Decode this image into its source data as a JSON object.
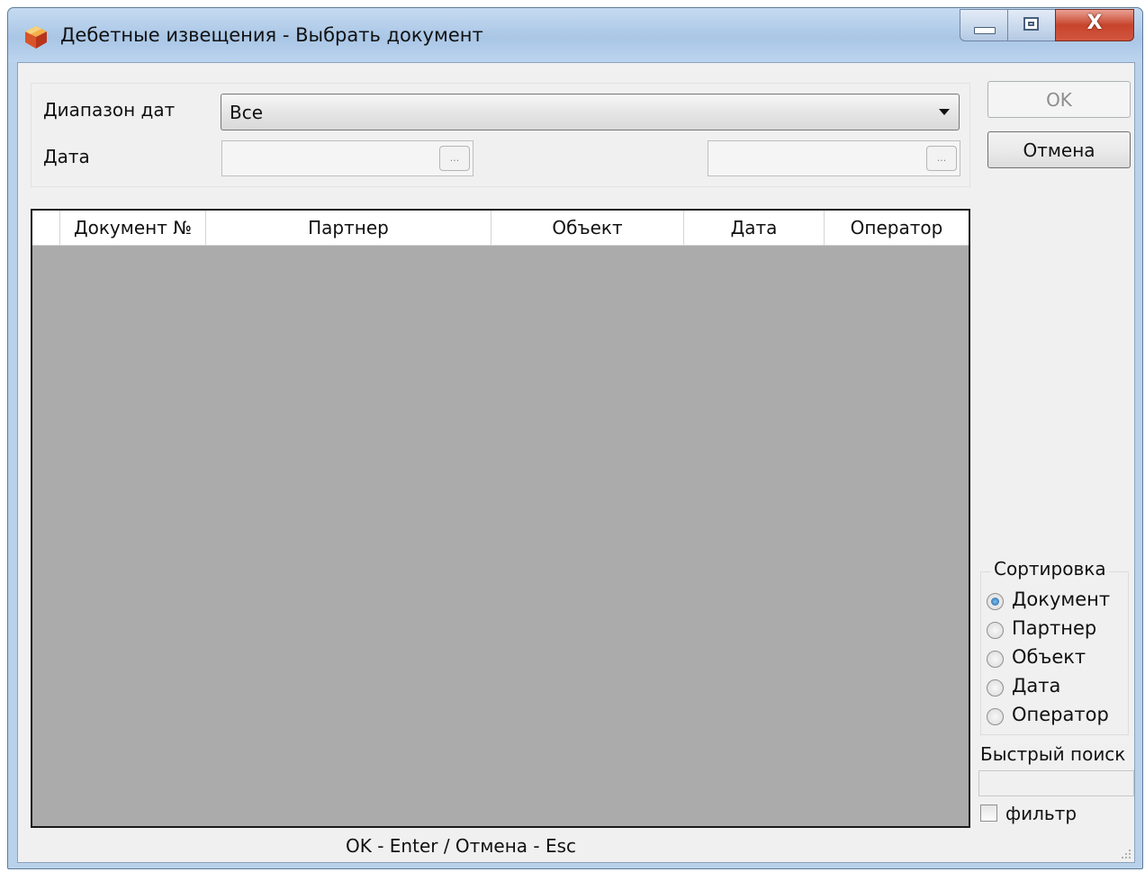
{
  "window": {
    "title": "Дебетные извещения - Выбрать документ",
    "close_glyph": "X",
    "accent_color": "#b9d1ea"
  },
  "filter": {
    "date_range_label": "Диапазон дат",
    "date_range_value": "Все",
    "date_label": "Дата",
    "browse_glyph": "..."
  },
  "buttons": {
    "ok": "OK",
    "cancel": "Отмена"
  },
  "table": {
    "columns": [
      "Документ №",
      "Партнер",
      "Объект",
      "Дата",
      "Оператор"
    ],
    "rows": []
  },
  "sort": {
    "legend": "Сортировка",
    "options": [
      "Документ",
      "Партнер",
      "Объект",
      "Дата",
      "Оператор"
    ],
    "selected": "Документ"
  },
  "quick_search": {
    "label": "Быстрый поиск",
    "value": ""
  },
  "filter_checkbox": {
    "label": "фильтр",
    "checked": false
  },
  "status": {
    "hint": "OK - Enter / Отмена - Esc"
  }
}
